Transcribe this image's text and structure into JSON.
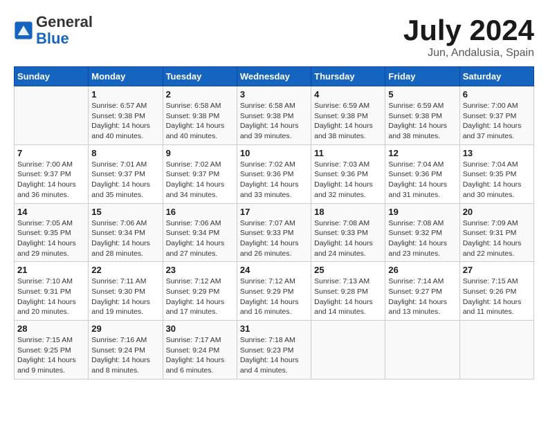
{
  "logo": {
    "general": "General",
    "blue": "Blue"
  },
  "title": "July 2024",
  "subtitle": "Jun, Andalusia, Spain",
  "header_row": [
    "Sunday",
    "Monday",
    "Tuesday",
    "Wednesday",
    "Thursday",
    "Friday",
    "Saturday"
  ],
  "weeks": [
    [
      {
        "day": "",
        "info": ""
      },
      {
        "day": "1",
        "info": "Sunrise: 6:57 AM\nSunset: 9:38 PM\nDaylight: 14 hours\nand 40 minutes."
      },
      {
        "day": "2",
        "info": "Sunrise: 6:58 AM\nSunset: 9:38 PM\nDaylight: 14 hours\nand 40 minutes."
      },
      {
        "day": "3",
        "info": "Sunrise: 6:58 AM\nSunset: 9:38 PM\nDaylight: 14 hours\nand 39 minutes."
      },
      {
        "day": "4",
        "info": "Sunrise: 6:59 AM\nSunset: 9:38 PM\nDaylight: 14 hours\nand 38 minutes."
      },
      {
        "day": "5",
        "info": "Sunrise: 6:59 AM\nSunset: 9:38 PM\nDaylight: 14 hours\nand 38 minutes."
      },
      {
        "day": "6",
        "info": "Sunrise: 7:00 AM\nSunset: 9:37 PM\nDaylight: 14 hours\nand 37 minutes."
      }
    ],
    [
      {
        "day": "7",
        "info": "Sunrise: 7:00 AM\nSunset: 9:37 PM\nDaylight: 14 hours\nand 36 minutes."
      },
      {
        "day": "8",
        "info": "Sunrise: 7:01 AM\nSunset: 9:37 PM\nDaylight: 14 hours\nand 35 minutes."
      },
      {
        "day": "9",
        "info": "Sunrise: 7:02 AM\nSunset: 9:37 PM\nDaylight: 14 hours\nand 34 minutes."
      },
      {
        "day": "10",
        "info": "Sunrise: 7:02 AM\nSunset: 9:36 PM\nDaylight: 14 hours\nand 33 minutes."
      },
      {
        "day": "11",
        "info": "Sunrise: 7:03 AM\nSunset: 9:36 PM\nDaylight: 14 hours\nand 32 minutes."
      },
      {
        "day": "12",
        "info": "Sunrise: 7:04 AM\nSunset: 9:36 PM\nDaylight: 14 hours\nand 31 minutes."
      },
      {
        "day": "13",
        "info": "Sunrise: 7:04 AM\nSunset: 9:35 PM\nDaylight: 14 hours\nand 30 minutes."
      }
    ],
    [
      {
        "day": "14",
        "info": "Sunrise: 7:05 AM\nSunset: 9:35 PM\nDaylight: 14 hours\nand 29 minutes."
      },
      {
        "day": "15",
        "info": "Sunrise: 7:06 AM\nSunset: 9:34 PM\nDaylight: 14 hours\nand 28 minutes."
      },
      {
        "day": "16",
        "info": "Sunrise: 7:06 AM\nSunset: 9:34 PM\nDaylight: 14 hours\nand 27 minutes."
      },
      {
        "day": "17",
        "info": "Sunrise: 7:07 AM\nSunset: 9:33 PM\nDaylight: 14 hours\nand 26 minutes."
      },
      {
        "day": "18",
        "info": "Sunrise: 7:08 AM\nSunset: 9:33 PM\nDaylight: 14 hours\nand 24 minutes."
      },
      {
        "day": "19",
        "info": "Sunrise: 7:08 AM\nSunset: 9:32 PM\nDaylight: 14 hours\nand 23 minutes."
      },
      {
        "day": "20",
        "info": "Sunrise: 7:09 AM\nSunset: 9:31 PM\nDaylight: 14 hours\nand 22 minutes."
      }
    ],
    [
      {
        "day": "21",
        "info": "Sunrise: 7:10 AM\nSunset: 9:31 PM\nDaylight: 14 hours\nand 20 minutes."
      },
      {
        "day": "22",
        "info": "Sunrise: 7:11 AM\nSunset: 9:30 PM\nDaylight: 14 hours\nand 19 minutes."
      },
      {
        "day": "23",
        "info": "Sunrise: 7:12 AM\nSunset: 9:29 PM\nDaylight: 14 hours\nand 17 minutes."
      },
      {
        "day": "24",
        "info": "Sunrise: 7:12 AM\nSunset: 9:29 PM\nDaylight: 14 hours\nand 16 minutes."
      },
      {
        "day": "25",
        "info": "Sunrise: 7:13 AM\nSunset: 9:28 PM\nDaylight: 14 hours\nand 14 minutes."
      },
      {
        "day": "26",
        "info": "Sunrise: 7:14 AM\nSunset: 9:27 PM\nDaylight: 14 hours\nand 13 minutes."
      },
      {
        "day": "27",
        "info": "Sunrise: 7:15 AM\nSunset: 9:26 PM\nDaylight: 14 hours\nand 11 minutes."
      }
    ],
    [
      {
        "day": "28",
        "info": "Sunrise: 7:15 AM\nSunset: 9:25 PM\nDaylight: 14 hours\nand 9 minutes."
      },
      {
        "day": "29",
        "info": "Sunrise: 7:16 AM\nSunset: 9:24 PM\nDaylight: 14 hours\nand 8 minutes."
      },
      {
        "day": "30",
        "info": "Sunrise: 7:17 AM\nSunset: 9:24 PM\nDaylight: 14 hours\nand 6 minutes."
      },
      {
        "day": "31",
        "info": "Sunrise: 7:18 AM\nSunset: 9:23 PM\nDaylight: 14 hours\nand 4 minutes."
      },
      {
        "day": "",
        "info": ""
      },
      {
        "day": "",
        "info": ""
      },
      {
        "day": "",
        "info": ""
      }
    ]
  ]
}
